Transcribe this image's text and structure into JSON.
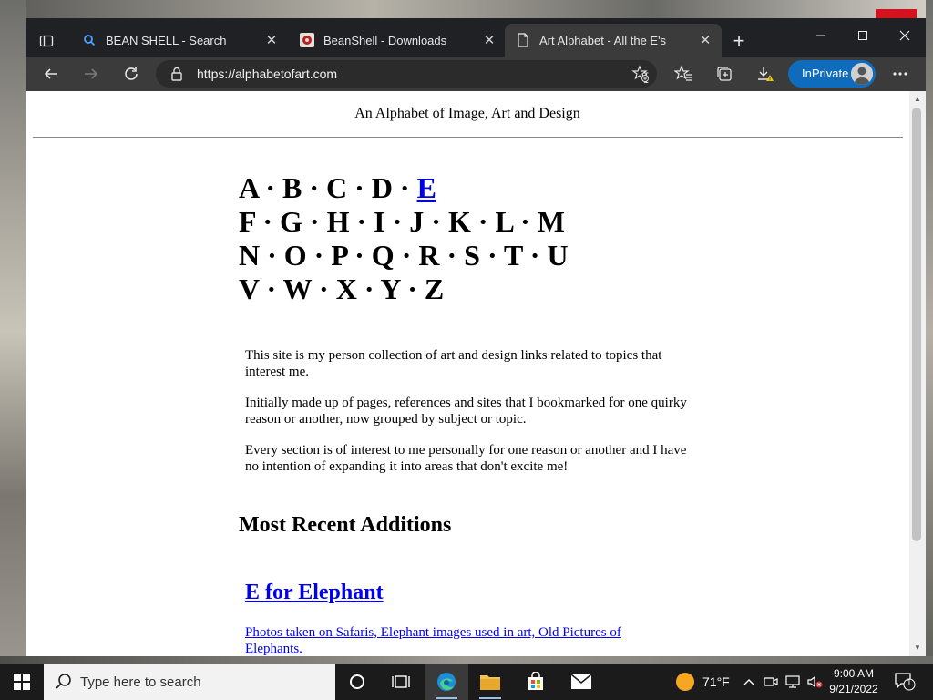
{
  "browser": {
    "tabs": [
      {
        "title": "BEAN SHELL - Search",
        "icon": "bing-search-icon",
        "active": false
      },
      {
        "title": "BeanShell - Downloads",
        "icon": "beanshell-favicon",
        "active": false
      },
      {
        "title": "Art Alphabet - All the E's",
        "icon": "page-icon",
        "active": true
      }
    ],
    "url": "https://alphabetofart.com",
    "inprivate_label": "InPrivate",
    "accent": "#0f6cbd"
  },
  "page": {
    "site_title": "An Alphabet of Image, Art and Design",
    "alphabet": {
      "row1": [
        "A",
        "B",
        "C",
        "D"
      ],
      "row1_link": "E",
      "row2": "F · G · H · I · J · K · L · M",
      "row3": "N · O · P · Q · R · S · T · U",
      "row4": "V · W · X · Y · Z",
      "separator": " · "
    },
    "intro": [
      "This site is my person collection of art and design links related to topics that interest me.",
      "Initially made up of pages, references and sites that I bookmarked for one quirky reason or another, now grouped by subject or topic.",
      "Every section is of interest to me personally for one reason or another and I have no intention of expanding it into areas that don't excite me!"
    ],
    "recent_heading": "Most Recent Additions",
    "entries": [
      {
        "title": "E for Elephant",
        "desc": "Photos taken on Safaris, Elephant images used in art, Old Pictures of Elephants."
      }
    ],
    "link_color": "#0000ee"
  },
  "taskbar": {
    "search_placeholder": "Type here to search",
    "temperature": "71°F",
    "time": "9:00 AM",
    "date": "9/21/2022",
    "notification_count": "1"
  }
}
